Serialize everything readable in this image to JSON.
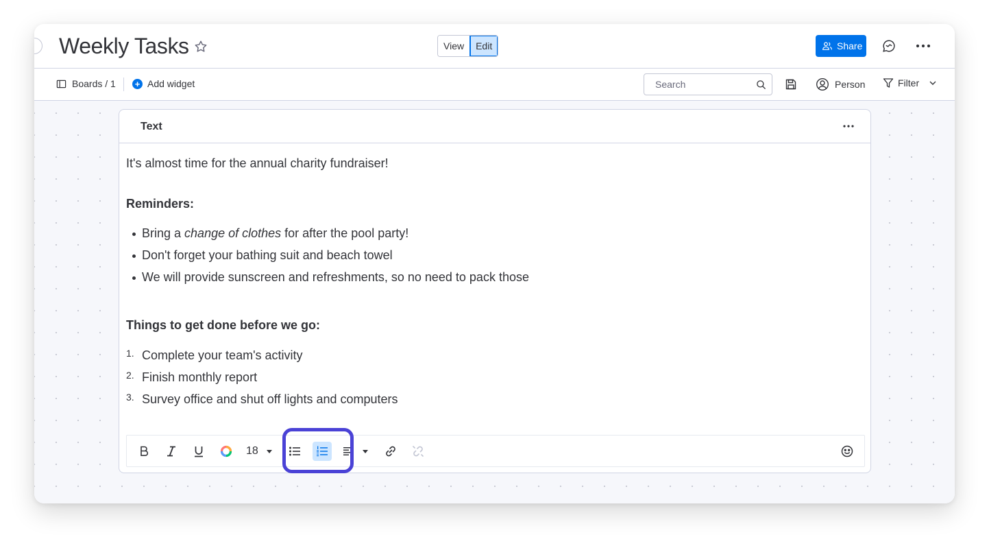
{
  "header": {
    "board_title": "Weekly Tasks",
    "view_label": "View",
    "edit_label": "Edit",
    "share_label": "Share",
    "accent_color": "#0073ea"
  },
  "toolbar": {
    "boards_label": "Boards / 1",
    "add_widget_label": "Add widget",
    "search_placeholder": "Search",
    "person_label": "Person",
    "filter_label": "Filter"
  },
  "widget": {
    "title": "Text",
    "intro": "It's almost time for the annual charity fundraiser!",
    "reminders_heading": "Reminders:",
    "reminders": [
      {
        "before": "Bring a ",
        "italic": "change of clothes",
        "after": " for after the pool party!"
      },
      {
        "before": "Don't forget your bathing suit and beach towel",
        "italic": "",
        "after": ""
      },
      {
        "before": "We will provide sunscreen and refreshments, so no need to pack those",
        "italic": "",
        "after": ""
      }
    ],
    "todo_heading": "Things to get done before we go:",
    "todos": [
      {
        "num": "1.",
        "text": "Complete your team's activity"
      },
      {
        "num": "2.",
        "text": "Finish monthly report"
      },
      {
        "num": "3.",
        "text": "Survey office and shut off lights and computers"
      }
    ]
  },
  "editor_toolbar": {
    "font_size": "18",
    "tools": [
      "bold-icon",
      "italic-icon",
      "underline-icon",
      "color-icon",
      "bullet-list-icon",
      "numbered-list-icon",
      "align-icon",
      "link-icon",
      "unlink-icon",
      "emoji-icon"
    ],
    "highlight_color": "#4a42d6"
  }
}
